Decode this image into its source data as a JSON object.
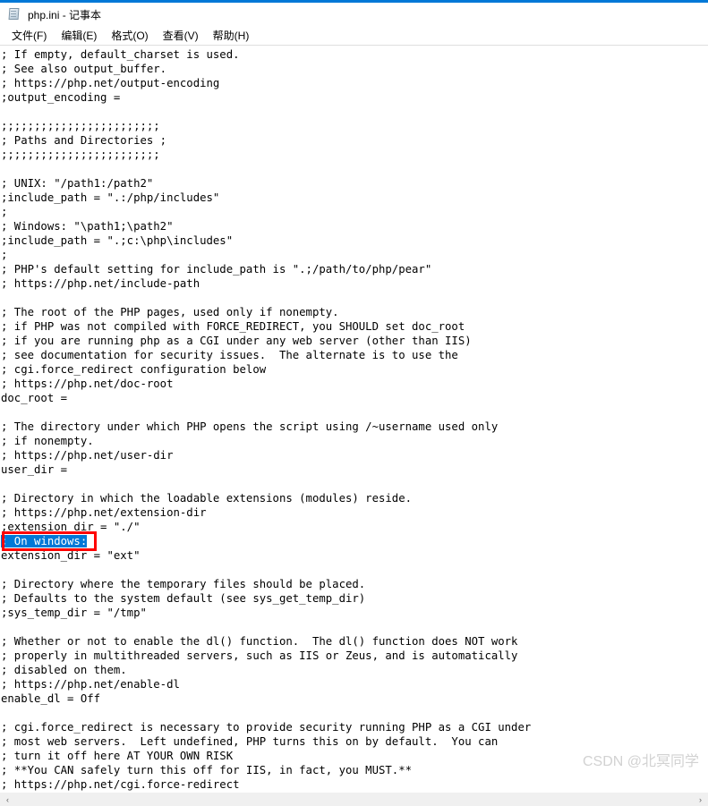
{
  "window": {
    "accent_color": "#0078d7",
    "title": "php.ini - 记事本",
    "icon": "notepad-icon"
  },
  "menubar": {
    "items": [
      {
        "label": "文件(F)",
        "name": "menu-file"
      },
      {
        "label": "编辑(E)",
        "name": "menu-edit"
      },
      {
        "label": "格式(O)",
        "name": "menu-format"
      },
      {
        "label": "查看(V)",
        "name": "menu-view"
      },
      {
        "label": "帮助(H)",
        "name": "menu-help"
      }
    ]
  },
  "editor": {
    "lines": [
      "; If empty, default_charset is used.",
      "; See also output_buffer.",
      "; https://php.net/output-encoding",
      ";output_encoding =",
      "",
      ";;;;;;;;;;;;;;;;;;;;;;;;",
      "; Paths and Directories ;",
      ";;;;;;;;;;;;;;;;;;;;;;;;",
      "",
      "; UNIX: \"/path1:/path2\"",
      ";include_path = \".:/php/includes\"",
      ";",
      "; Windows: \"\\path1;\\path2\"",
      ";include_path = \".;c:\\php\\includes\"",
      ";",
      "; PHP's default setting for include_path is \".;/path/to/php/pear\"",
      "; https://php.net/include-path",
      "",
      "; The root of the PHP pages, used only if nonempty.",
      "; if PHP was not compiled with FORCE_REDIRECT, you SHOULD set doc_root",
      "; if you are running php as a CGI under any web server (other than IIS)",
      "; see documentation for security issues.  The alternate is to use the",
      "; cgi.force_redirect configuration below",
      "; https://php.net/doc-root",
      "doc_root =",
      "",
      "; The directory under which PHP opens the script using /~username used only",
      "; if nonempty.",
      "; https://php.net/user-dir",
      "user_dir =",
      "",
      "; Directory in which the loadable extensions (modules) reside.",
      "; https://php.net/extension-dir",
      ";extension_dir = \"./\"",
      "; On windows:",
      "extension_dir = \"ext\"",
      "",
      "; Directory where the temporary files should be placed.",
      "; Defaults to the system default (see sys_get_temp_dir)",
      ";sys_temp_dir = \"/tmp\"",
      "",
      "; Whether or not to enable the dl() function.  The dl() function does NOT work",
      "; properly in multithreaded servers, such as IIS or Zeus, and is automatically",
      "; disabled on them.",
      "; https://php.net/enable-dl",
      "enable_dl = Off",
      "",
      "; cgi.force_redirect is necessary to provide security running PHP as a CGI under",
      "; most web servers.  Left undefined, PHP turns this on by default.  You can",
      "; turn it off here AT YOUR OWN RISK",
      "; **You CAN safely turn this off for IIS, in fact, you MUST.**",
      "; https://php.net/cgi.force-redirect",
      ";"
    ],
    "selected_line_index": 34,
    "selected_text": "extension_dir = \"ext\"",
    "selection_background": "#0078d7",
    "selection_foreground": "#ffffff"
  },
  "annotation": {
    "color": "#ff0000",
    "target_text": "extension_dir = \"ext\""
  },
  "watermark": {
    "text": "CSDN @北冥同学",
    "color": "#d2d2d2"
  },
  "scrollbar": {
    "left_arrow": "‹",
    "right_arrow": "›"
  }
}
